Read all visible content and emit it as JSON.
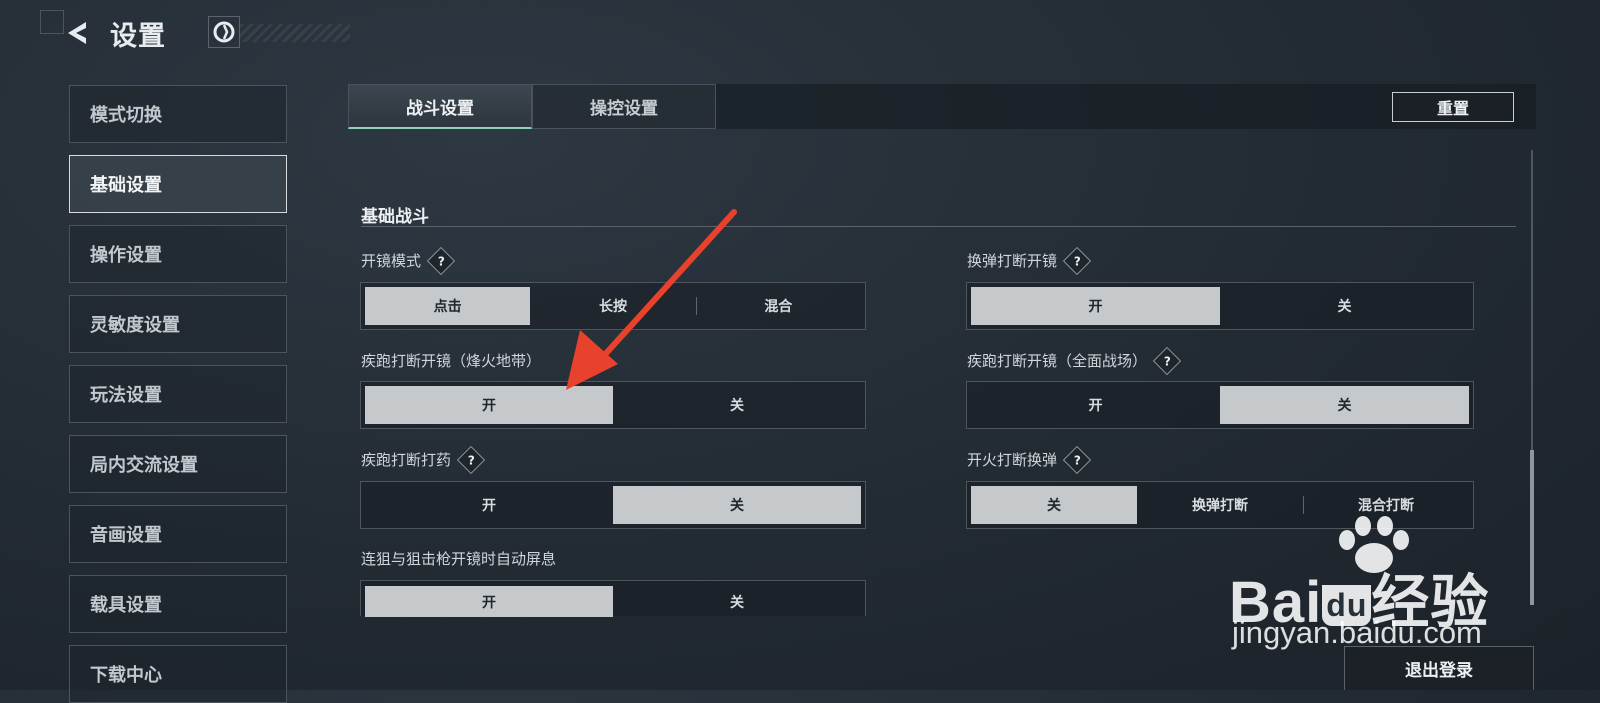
{
  "header": {
    "title": "设置"
  },
  "sidebar": {
    "items": [
      {
        "label": "模式切换",
        "active": false
      },
      {
        "label": "基础设置",
        "active": true
      },
      {
        "label": "操作设置",
        "active": false
      },
      {
        "label": "灵敏度设置",
        "active": false
      },
      {
        "label": "玩法设置",
        "active": false
      },
      {
        "label": "局内交流设置",
        "active": false
      },
      {
        "label": "音画设置",
        "active": false
      },
      {
        "label": "载具设置",
        "active": false
      },
      {
        "label": "下载中心",
        "active": false
      }
    ]
  },
  "tabs": [
    {
      "label": "战斗设置",
      "active": true
    },
    {
      "label": "操控设置",
      "active": false
    }
  ],
  "reset_label": "重置",
  "section": {
    "title": "基础战斗"
  },
  "help_mark": "?",
  "settings": {
    "scope_mode": {
      "label": "开镜模式",
      "options": [
        "点击",
        "长按",
        "混合"
      ],
      "selected": "点击"
    },
    "reload_interrupt_scope": {
      "label": "换弹打断开镜",
      "options": [
        "开",
        "关"
      ],
      "selected": "开"
    },
    "sprint_interrupt_scope_beacon": {
      "label": "疾跑打断开镜（烽火地带）",
      "options": [
        "开",
        "关"
      ],
      "selected": "开"
    },
    "sprint_interrupt_scope_full": {
      "label": "疾跑打断开镜（全面战场）",
      "options": [
        "开",
        "关"
      ],
      "selected": "关"
    },
    "sprint_interrupt_heal": {
      "label": "疾跑打断打药",
      "options": [
        "开",
        "关"
      ],
      "selected": "关"
    },
    "fire_interrupt_reload": {
      "label": "开火打断换弹",
      "options": [
        "关",
        "换弹打断",
        "混合打断"
      ],
      "selected": "关"
    },
    "auto_hold_breath": {
      "label": "连狙与狙击枪开镜时自动屏息",
      "options": [
        "开",
        "关"
      ],
      "selected": "开"
    }
  },
  "logout_label": "退出登录",
  "watermark": {
    "brand_left": "Bai",
    "brand_du": "du",
    "brand_right": "经验",
    "url": "jingyan.baidu.com"
  },
  "colors": {
    "accent": "#8fd3b5",
    "selected_option": "#c5c9cc",
    "arrow": "#e8412c"
  }
}
